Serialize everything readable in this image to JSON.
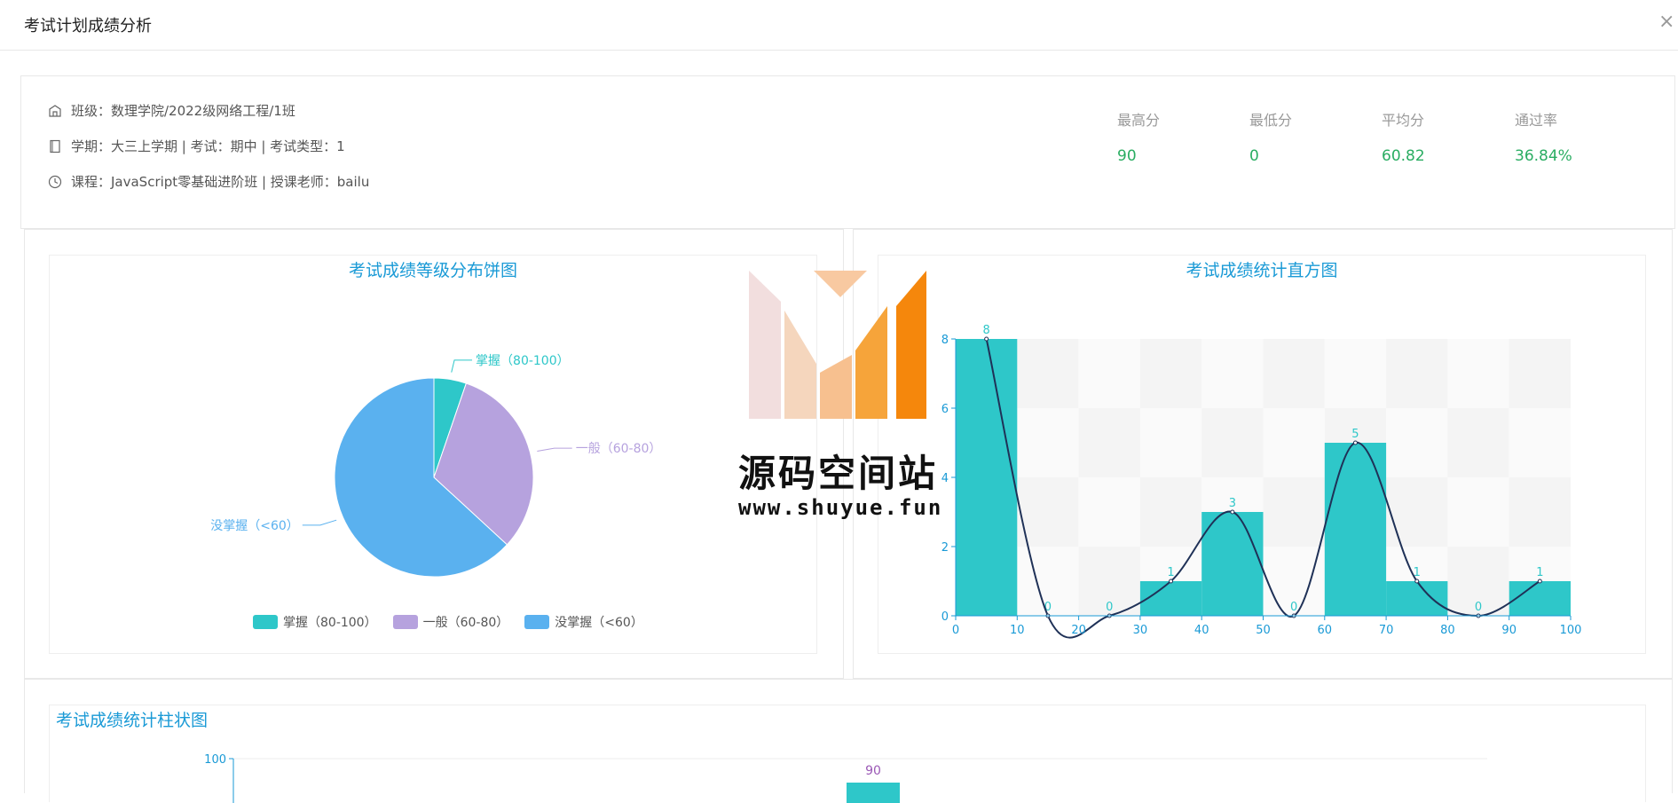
{
  "modal": {
    "title": "考试计划成绩分析",
    "close_label": "×"
  },
  "info": {
    "class_label": "班级：数理学院/2022级网络工程/1班",
    "term_line": "学期：大三上学期 | 考试：期中 | 考试类型：1",
    "course_line": "课程：JavaScript零基础进阶班 | 授课老师：bailu"
  },
  "stats": [
    {
      "label": "最高分",
      "value": "90"
    },
    {
      "label": "最低分",
      "value": "0"
    },
    {
      "label": "平均分",
      "value": "60.82"
    },
    {
      "label": "通过率",
      "value": "36.84%"
    }
  ],
  "colors": {
    "teal": "#2ec7c9",
    "purple": "#b6a2de",
    "blue": "#5ab1ef",
    "title_blue": "#1a9ad6",
    "green": "#2aad62",
    "curve": "#1f3157"
  },
  "pie_panel": {
    "title": "考试成绩等级分布饼图"
  },
  "hist_panel": {
    "title": "考试成绩统计直方图"
  },
  "bar_panel": {
    "title": "考试成绩统计柱状图"
  },
  "watermark": {
    "name": "源码空间站",
    "url": "www.shuyue.fun"
  },
  "chart_data": [
    {
      "type": "pie",
      "title": "考试成绩等级分布饼图",
      "slices": [
        {
          "name": "掌握（80-100）",
          "value": 1,
          "color": "#2ec7c9"
        },
        {
          "name": "一般（60-80）",
          "value": 6,
          "color": "#b6a2de"
        },
        {
          "name": "没掌握（<60）",
          "value": 12,
          "color": "#5ab1ef"
        }
      ],
      "legend": "bottom"
    },
    {
      "type": "bar",
      "title": "考试成绩统计直方图",
      "bin_edges": [
        0,
        10,
        20,
        30,
        40,
        50,
        60,
        70,
        80,
        90,
        100
      ],
      "x_ticks": [
        "0",
        "10",
        "20",
        "30",
        "40",
        "50",
        "60",
        "70",
        "80",
        "90",
        "100"
      ],
      "values": [
        8,
        0,
        0,
        1,
        3,
        0,
        5,
        1,
        0,
        1
      ],
      "y_ticks": [
        "0",
        "2",
        "4",
        "6",
        "8"
      ],
      "ylim": [
        0,
        8
      ],
      "xlim": [
        0,
        100
      ],
      "smooth_line": true,
      "grid": true
    },
    {
      "type": "bar",
      "title": "考试成绩统计柱状图",
      "y_ticks": [
        "100"
      ],
      "visible_labels": [
        "90"
      ]
    }
  ]
}
